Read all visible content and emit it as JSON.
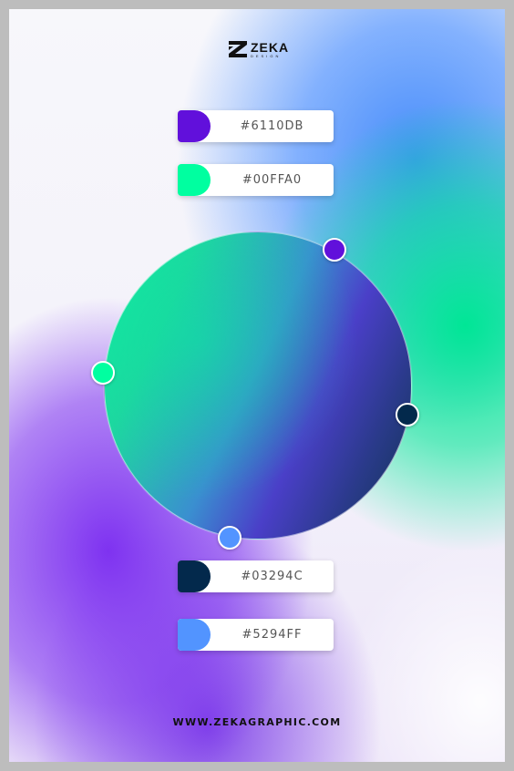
{
  "brand": {
    "name": "ZEKA",
    "subtitle": "DESIGN"
  },
  "swatches": [
    {
      "hex": "#6110DB",
      "color": "#6110DB"
    },
    {
      "hex": "#00FFA0",
      "color": "#00FFA0"
    },
    {
      "hex": "#03294C",
      "color": "#03294C"
    },
    {
      "hex": "#5294FF",
      "color": "#5294FF"
    }
  ],
  "handles": [
    {
      "color": "#6110DB",
      "icon": "color-stop-handle"
    },
    {
      "color": "#00FFA0",
      "icon": "color-stop-handle"
    },
    {
      "color": "#03294C",
      "icon": "color-stop-handle"
    },
    {
      "color": "#5294FF",
      "icon": "color-stop-handle"
    }
  ],
  "footer": {
    "url": "WWW.ZEKAGRAPHIC.COM"
  }
}
